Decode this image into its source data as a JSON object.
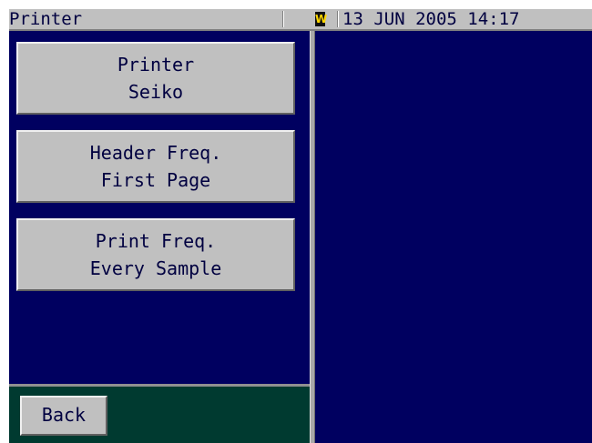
{
  "titlebar": {
    "title": "Printer",
    "warning_icon": "W",
    "datetime": "13 JUN 2005 14:17"
  },
  "menu": {
    "items": [
      {
        "line1": "Printer",
        "line2": "Seiko"
      },
      {
        "line1": "Header Freq.",
        "line2": "First Page"
      },
      {
        "line1": "Print Freq.",
        "line2": "Every Sample"
      }
    ]
  },
  "footer": {
    "back_label": "Back"
  },
  "colors": {
    "panel_background": "#000060",
    "footer_background": "#003a30",
    "button_face": "#c0c0c0",
    "text": "#000040",
    "warning_icon_color": "#ffd700"
  }
}
